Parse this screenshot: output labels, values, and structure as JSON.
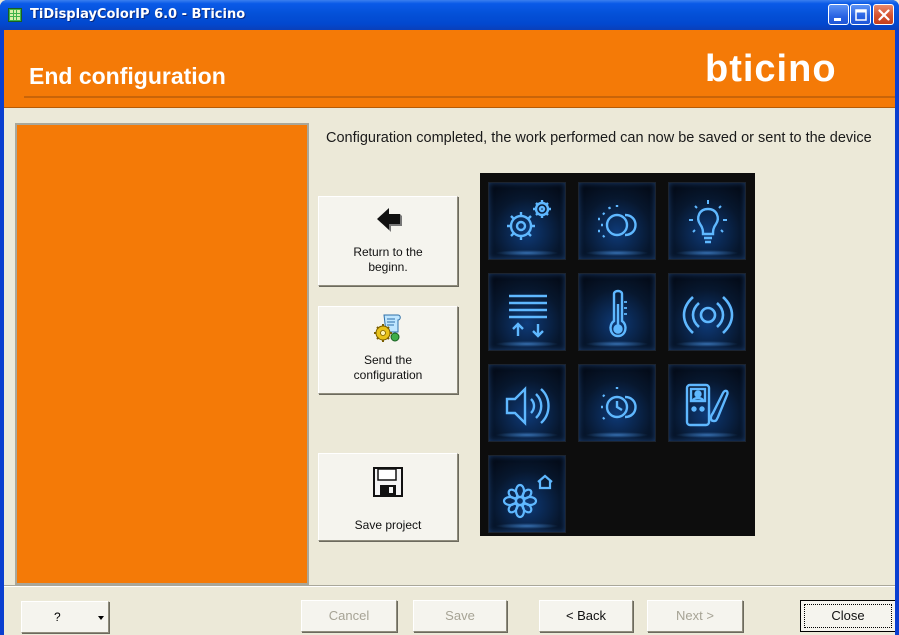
{
  "window": {
    "title": "TiDisplayColorIP 6.0 - BTicino",
    "buttons": [
      "minimize",
      "maximize",
      "close"
    ]
  },
  "header": {
    "title": "End configuration",
    "brand": "bticino",
    "background_color": "#f47a07"
  },
  "main": {
    "message": "Configuration completed, the work performed can now be saved or sent to the device",
    "actions": [
      {
        "label_lines": [
          "Return to the",
          "beginn."
        ],
        "icon": "back-arrow-icon"
      },
      {
        "label_lines": [
          "Send the",
          "configuration"
        ],
        "icon": "send-config-icon"
      },
      {
        "label_lines": [
          "Save project"
        ],
        "icon": "floppy-disk-icon"
      }
    ],
    "device_tiles": [
      "settings-gears-icon",
      "scenario-light-icon",
      "light-bulb-icon",
      "shutters-icon",
      "thermometer-icon",
      "alarm-broadcast-icon",
      "speaker-icon",
      "timed-scenario-icon",
      "videodoorphone-icon",
      "home-flower-icon"
    ]
  },
  "footer": {
    "help_label": "?",
    "cancel_label": "Cancel",
    "save_label": "Save",
    "back_label": "< Back",
    "next_label": "Next >",
    "close_label": "Close",
    "disabled": [
      "Cancel",
      "Save",
      "Next >"
    ]
  }
}
